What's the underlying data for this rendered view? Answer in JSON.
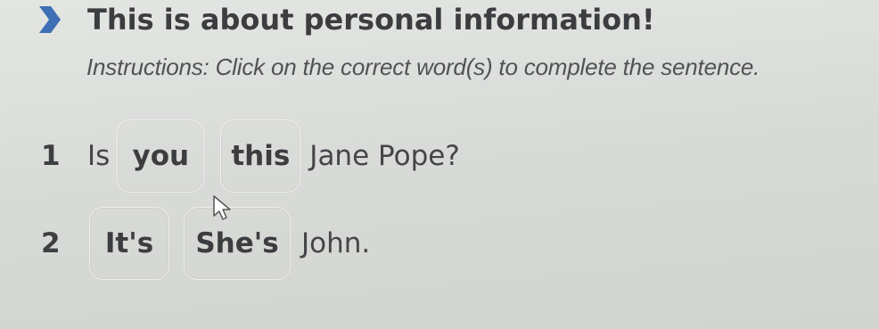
{
  "header": {
    "title": "This is about personal information!",
    "icon": "chevron-right-icon",
    "icon_color": "#3f6fb5"
  },
  "instructions": "Instructions: Click on the correct word(s) to complete the sentence.",
  "questions": [
    {
      "number": "1",
      "prefix": "Is",
      "options": [
        "you",
        "this"
      ],
      "suffix": "Jane Pope?"
    },
    {
      "number": "2",
      "prefix": "",
      "options": [
        "It's",
        "She's"
      ],
      "suffix": "John."
    }
  ]
}
